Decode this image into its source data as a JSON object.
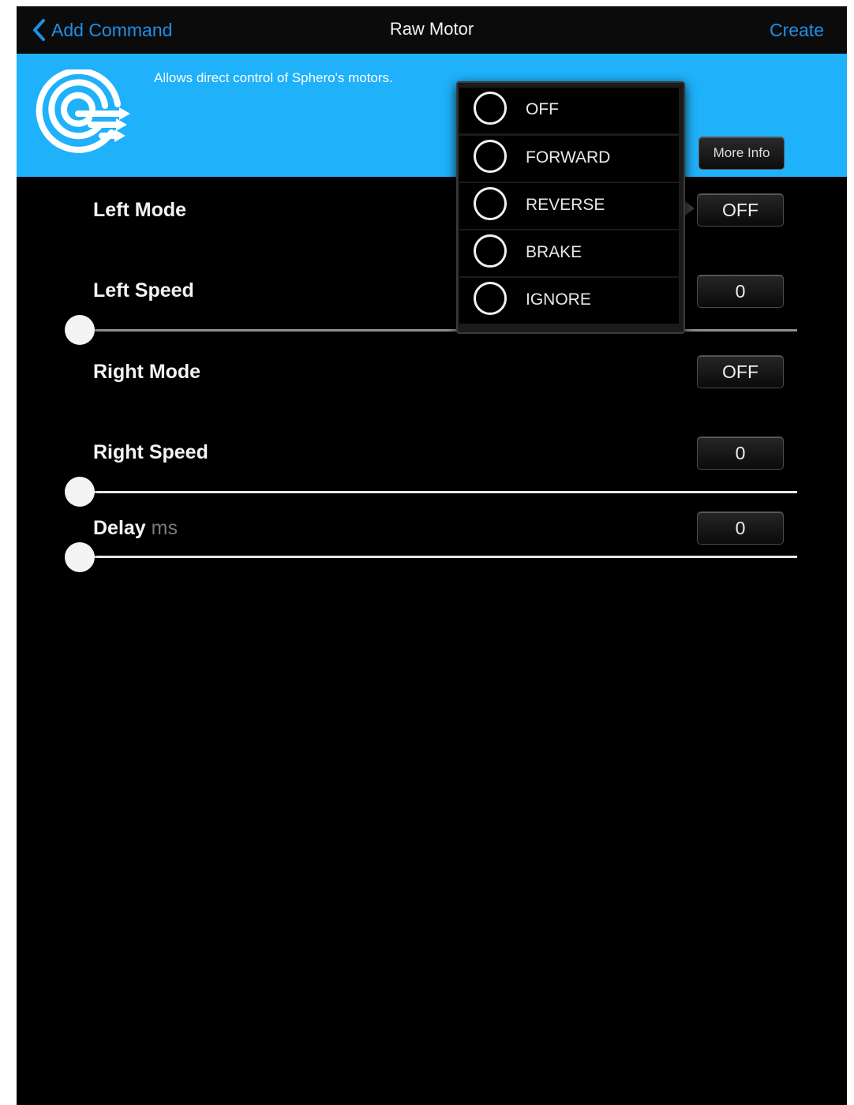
{
  "nav": {
    "back_label": "Add Command",
    "title": "Raw Motor",
    "create_label": "Create"
  },
  "banner": {
    "description": "Allows direct control of Sphero's motors.",
    "more_info_label": "More Info"
  },
  "rows": {
    "left_mode": {
      "label": "Left Mode",
      "value": "OFF"
    },
    "left_speed": {
      "label": "Left Speed",
      "value": "0"
    },
    "right_mode": {
      "label": "Right Mode",
      "value": "OFF"
    },
    "right_speed": {
      "label": "Right Speed",
      "value": "0"
    },
    "delay": {
      "label": "Delay",
      "unit": "ms",
      "value": "0"
    }
  },
  "mode_options": [
    "OFF",
    "FORWARD",
    "REVERSE",
    "BRAKE",
    "IGNORE"
  ],
  "colors": {
    "accent": "#1f8fe6",
    "banner": "#1fb1fa",
    "background": "#000000"
  }
}
